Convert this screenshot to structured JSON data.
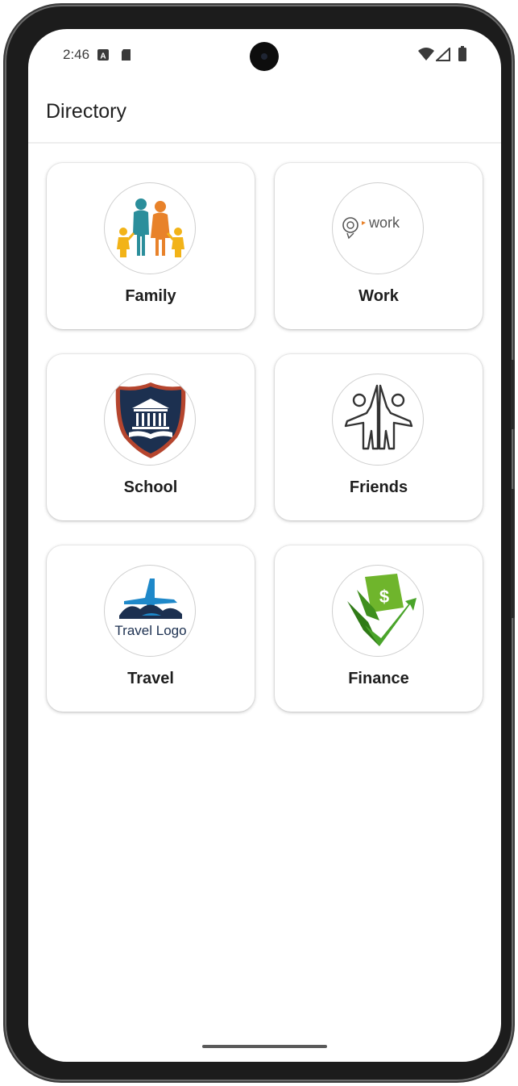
{
  "status_bar": {
    "time": "2:46",
    "icons": [
      "notification-a-icon",
      "sd-card-icon",
      "wifi-icon",
      "signal-icon",
      "battery-icon"
    ]
  },
  "app_bar": {
    "title": "Directory"
  },
  "categories": [
    {
      "label": "Family",
      "icon": "family-logo"
    },
    {
      "label": "Work",
      "icon": "work-logo",
      "logo_text": "work"
    },
    {
      "label": "School",
      "icon": "school-crest-logo"
    },
    {
      "label": "Friends",
      "icon": "friends-high-five-logo"
    },
    {
      "label": "Travel",
      "icon": "travel-logo",
      "logo_text": "Travel Logo"
    },
    {
      "label": "Finance",
      "icon": "finance-dollar-logo",
      "logo_text": "$"
    }
  ],
  "colors": {
    "teal": "#2b8e9b",
    "orange": "#e8822a",
    "yellow": "#f2b318",
    "navy": "#1c3050",
    "crest_red": "#b5452e",
    "travel_blue": "#1e88c9",
    "finance_green": "#6fb52c"
  }
}
